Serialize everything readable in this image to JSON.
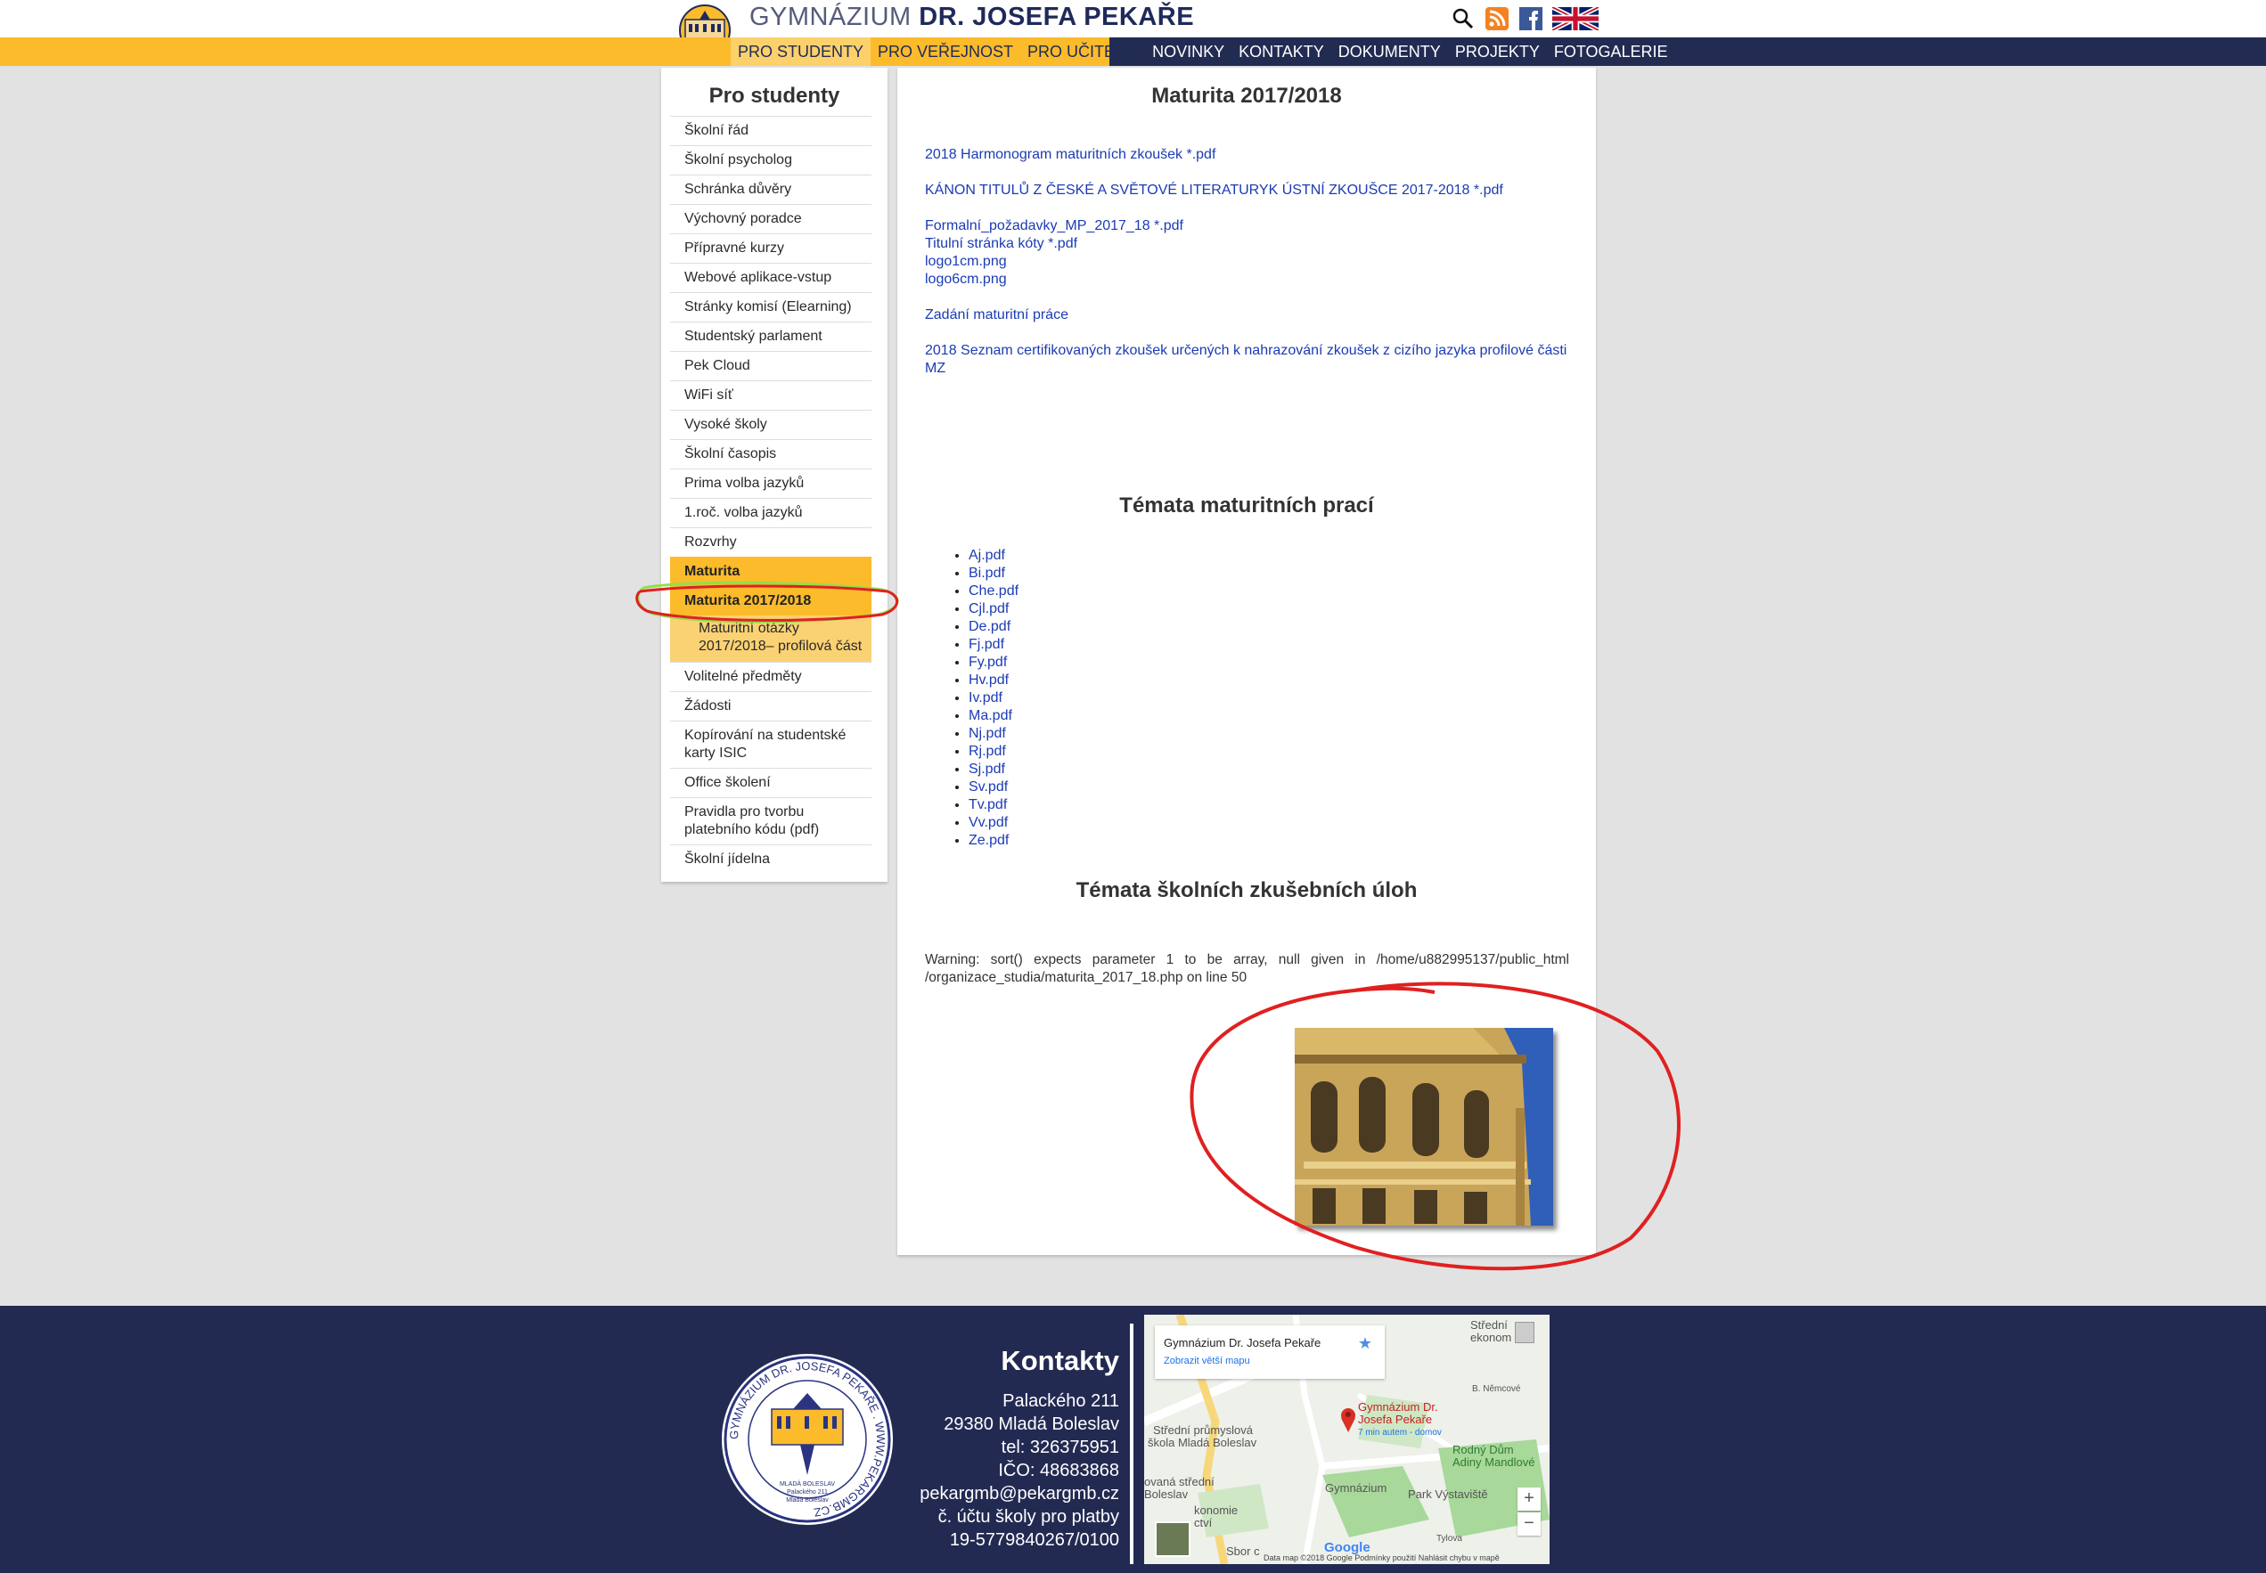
{
  "header": {
    "brand_prefix": "GYMNÁZIUM",
    "brand_name": "DR. JOSEFA PEKAŘE",
    "icons": [
      "search-icon",
      "rss-icon",
      "facebook-icon",
      "uk-flag-icon"
    ],
    "colors": {
      "yellow": "#fbbb2b",
      "navy": "#222b52",
      "link": "#1b3bb5"
    }
  },
  "nav": {
    "items": [
      {
        "label": "PRO STUDENTY",
        "style": "active"
      },
      {
        "label": "PRO VEŘEJNOST",
        "style": "light"
      },
      {
        "label": "PRO UČITELE",
        "style": "light"
      },
      {
        "label": "NOVINKY",
        "style": "dark"
      },
      {
        "label": "KONTAKTY",
        "style": "dark"
      },
      {
        "label": "DOKUMENTY",
        "style": "dark"
      },
      {
        "label": "PROJEKTY",
        "style": "dark"
      },
      {
        "label": "FOTOGALERIE",
        "style": "dark"
      }
    ]
  },
  "sidebar": {
    "title": "Pro studenty",
    "items": [
      {
        "label": "Školní řád"
      },
      {
        "label": "Školní psycholog"
      },
      {
        "label": "Schránka důvěry"
      },
      {
        "label": "Výchovný poradce"
      },
      {
        "label": "Přípravné kurzy"
      },
      {
        "label": "Webové aplikace-vstup"
      },
      {
        "label": "Stránky komisí (Elearning)"
      },
      {
        "label": "Studentský parlament"
      },
      {
        "label": "Pek Cloud"
      },
      {
        "label": "WiFi síť"
      },
      {
        "label": "Vysoké školy"
      },
      {
        "label": "Školní časopis"
      },
      {
        "label": "Prima volba jazyků"
      },
      {
        "label": "1.roč. volba jazyků"
      },
      {
        "label": "Rozvrhy"
      },
      {
        "label": "Maturita",
        "state": "parent"
      },
      {
        "label": "Maturita 2017/2018",
        "state": "current"
      },
      {
        "label": "Maturitní otázky 2017/2018– profilová část",
        "state": "sub"
      },
      {
        "label": "Volitelné předměty"
      },
      {
        "label": "Žádosti"
      },
      {
        "label": "Kopírování na studentské karty ISIC"
      },
      {
        "label": "Office školení"
      },
      {
        "label": "Pravidla pro tvorbu platebního kódu (pdf)"
      },
      {
        "label": "Školní jídelna"
      }
    ]
  },
  "main": {
    "title": "Maturita 2017/2018",
    "links": [
      "2018 Harmonogram maturitních zkoušek *.pdf",
      "KÁNON TITULŮ Z ČESKÉ A SVĚTOVÉ LITERATURYK ÚSTNÍ ZKOUŠCE 2017-2018 *.pdf",
      "Formalní_požadavky_MP_2017_18 *.pdf",
      "Titulní stránka kóty *.pdf",
      "logo1cm.png",
      "logo6cm.png",
      "Zadání maturitní práce",
      "2018 Seznam certifikovaných zkoušek určených k nahrazování zkoušek z cizího jazyka profilové části MZ"
    ],
    "theses_heading": "Témata maturitních prací",
    "theses_files": [
      "Aj.pdf",
      "Bi.pdf",
      "Che.pdf",
      "Cjl.pdf",
      "De.pdf",
      "Fj.pdf",
      "Fy.pdf",
      "Hv.pdf",
      "Iv.pdf",
      "Ma.pdf",
      "Nj.pdf",
      "Rj.pdf",
      "Sj.pdf",
      "Sv.pdf",
      "Tv.pdf",
      "Vv.pdf",
      "Ze.pdf"
    ],
    "exam_heading": "Témata školních zkušebních úloh",
    "warning": "Warning: sort() expects parameter 1 to be array, null given in /home/u882995137/public_html /organizace_studia/maturita_2017_18.php on line 50",
    "photo": "school-building-photo"
  },
  "footer": {
    "seal_ring_text": "GYMNÁZIUM DR. JOSEFA PEKAŘE . WWW.PEKARGMB.CZ",
    "seal_inner_lines": [
      "MLADÁ BOLESLAV",
      "Palackého 211",
      "Mladá Boleslav"
    ],
    "contacts_title": "Kontakty",
    "contact_lines": [
      "Palackého 211",
      "29380 Mladá Boleslav",
      "tel: 326375951",
      "IČO: 48683868",
      "pekargmb@pekargmb.cz",
      "č. účtu školy pro platby",
      "19-5779840267/0100"
    ],
    "map": {
      "card_title": "Gymnázium Dr. Josefa Pekaře",
      "card_link": "Zobrazit větší mapu",
      "pin_label_1": "Gymnázium Dr.",
      "pin_label_2": "Josefa Pekaře",
      "pin_sub": "7 min autem - domov",
      "labels": {
        "stredni": "Střední",
        "ekonom": "ekonom",
        "nemcova": "B. Němcové",
        "prumyslova_1": "Střední průmyslová",
        "prumyslova_2": "škola Mladá Boleslav",
        "rodny_1": "Rodný Dům",
        "rodny_2": "Adiny Mandlové",
        "gymnazium": "Gymnázium",
        "park": "Park Výstaviště",
        "vanast_1": "ovaná střední",
        "vanast_2": "Boleslav",
        "vanast_3": "konomie",
        "vanast_4": "ctví",
        "tylova": "Tylova",
        "sbor": "Sbor c"
      },
      "google": "Google",
      "footer_text": "Data map ©2018 Google   Podmínky použití   Nahlásit chybu v mapě",
      "zoom_in": "+",
      "zoom_out": "−",
      "star": "★"
    }
  }
}
